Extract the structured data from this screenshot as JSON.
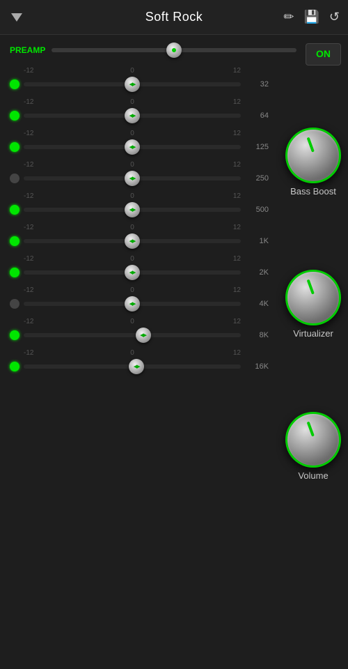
{
  "header": {
    "title": "Soft Rock",
    "icon_pencil": "✏",
    "icon_save": "💾",
    "icon_reset": "↺"
  },
  "on_button": "ON",
  "preamp": {
    "label": "PREAMP",
    "value": 50,
    "thumb_pct": 50
  },
  "scale": {
    "left": "-12",
    "center": "0",
    "right": "12"
  },
  "bands": [
    {
      "freq": "32",
      "thumb_pct": 50,
      "dot": "green"
    },
    {
      "freq": "64",
      "thumb_pct": 50,
      "dot": "green"
    },
    {
      "freq": "125",
      "thumb_pct": 50,
      "dot": "green"
    },
    {
      "freq": "250",
      "thumb_pct": 50,
      "dot": "dark"
    },
    {
      "freq": "500",
      "thumb_pct": 50,
      "dot": "green"
    },
    {
      "freq": "1K",
      "thumb_pct": 50,
      "dot": "green"
    },
    {
      "freq": "2K",
      "thumb_pct": 50,
      "dot": "green"
    },
    {
      "freq": "4K",
      "thumb_pct": 50,
      "dot": "dark"
    },
    {
      "freq": "8K",
      "thumb_pct": 50,
      "dot": "green"
    },
    {
      "freq": "16K",
      "thumb_pct": 50,
      "dot": "green"
    }
  ],
  "knobs": [
    {
      "slot": 1,
      "label": "Bass Boost",
      "rotation": -20
    },
    {
      "slot": 4,
      "label": "Virtualizer",
      "rotation": -20
    },
    {
      "slot": 7,
      "label": "Volume",
      "rotation": -20
    }
  ],
  "accent_color": "#00cc00"
}
